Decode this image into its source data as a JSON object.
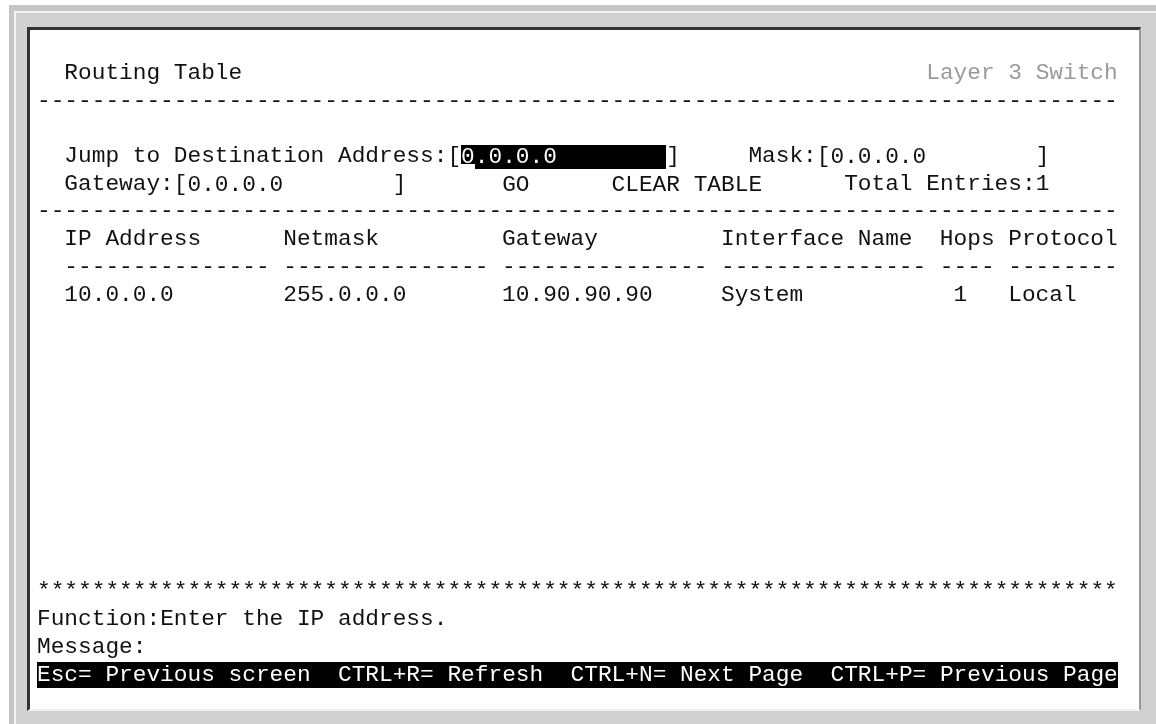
{
  "title": "Routing Table",
  "device_label": "Layer 3 Switch",
  "header_rule": "-------------------------------------------------------------------------------",
  "form": {
    "destination": {
      "label": "Jump to Destination Address:",
      "open_bracket": "[",
      "value": "0.0.0.0",
      "close_bracket": "]",
      "focused": true
    },
    "mask": {
      "label": "Mask:",
      "open_bracket": "[",
      "value": "0.0.0.0",
      "close_bracket": "]",
      "focused": false
    },
    "gateway": {
      "label": "Gateway:",
      "open_bracket": "[",
      "value": "0.0.0.0",
      "close_bracket": "]",
      "focused": false
    },
    "buttons": [
      "GO",
      "CLEAR TABLE"
    ],
    "total_entries": {
      "label": "Total Entries:",
      "value": "1"
    }
  },
  "form_rule": "-------------------------------------------------------------------------------",
  "table": {
    "columns": [
      {
        "label": "IP Address",
        "underline": "---------------"
      },
      {
        "label": "Netmask",
        "underline": "---------------"
      },
      {
        "label": "Gateway",
        "underline": "---------------"
      },
      {
        "label": "Interface Name",
        "underline": "---------------"
      },
      {
        "label": "Hops",
        "underline": "----"
      },
      {
        "label": "Protocol",
        "underline": "--------"
      }
    ],
    "rows": [
      [
        "10.0.0.0",
        "255.0.0.0",
        "10.90.90.90",
        "System",
        "1",
        "Local"
      ]
    ]
  },
  "footer_rule": "*******************************************************************************",
  "function": {
    "label": "Function:",
    "text": "Enter the IP address."
  },
  "message": {
    "label": "Message:"
  },
  "key_hints": [
    "Esc= Previous screen",
    "CTRL+R= Refresh",
    "CTRL+N= Next Page",
    "CTRL+P= Previous Page"
  ]
}
